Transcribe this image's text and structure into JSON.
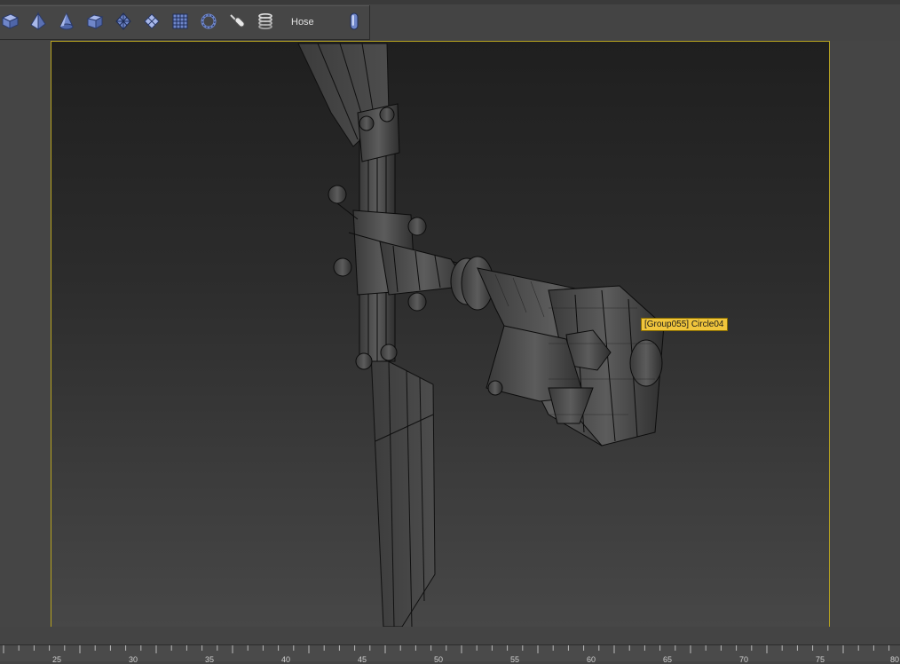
{
  "toolbar": {
    "buttons": [
      {
        "icon": "box-icon"
      },
      {
        "icon": "tetra-icon"
      },
      {
        "icon": "cone-icon"
      },
      {
        "icon": "chamfer-box-icon"
      },
      {
        "icon": "geosphere-icon"
      },
      {
        "icon": "plane-diamond-icon"
      },
      {
        "icon": "grid-plane-icon"
      },
      {
        "icon": "torus-knot-icon"
      },
      {
        "icon": "capsule-tool-icon"
      },
      {
        "icon": "spring-icon"
      }
    ],
    "hose_label": "Hose",
    "hose_icon": "hose-capsule-icon"
  },
  "viewport": {
    "tooltip": "[Group055] Circle04",
    "border_color": "#b8a41f"
  },
  "timeline_ruler": {
    "labels": [
      "25",
      "30",
      "35",
      "40",
      "45",
      "50",
      "55",
      "60",
      "65",
      "70",
      "75",
      "80"
    ]
  },
  "colors": {
    "ui_bg": "#444444",
    "tooltip_bg": "#f0c53c",
    "icon_blue": "#6f86c9"
  }
}
